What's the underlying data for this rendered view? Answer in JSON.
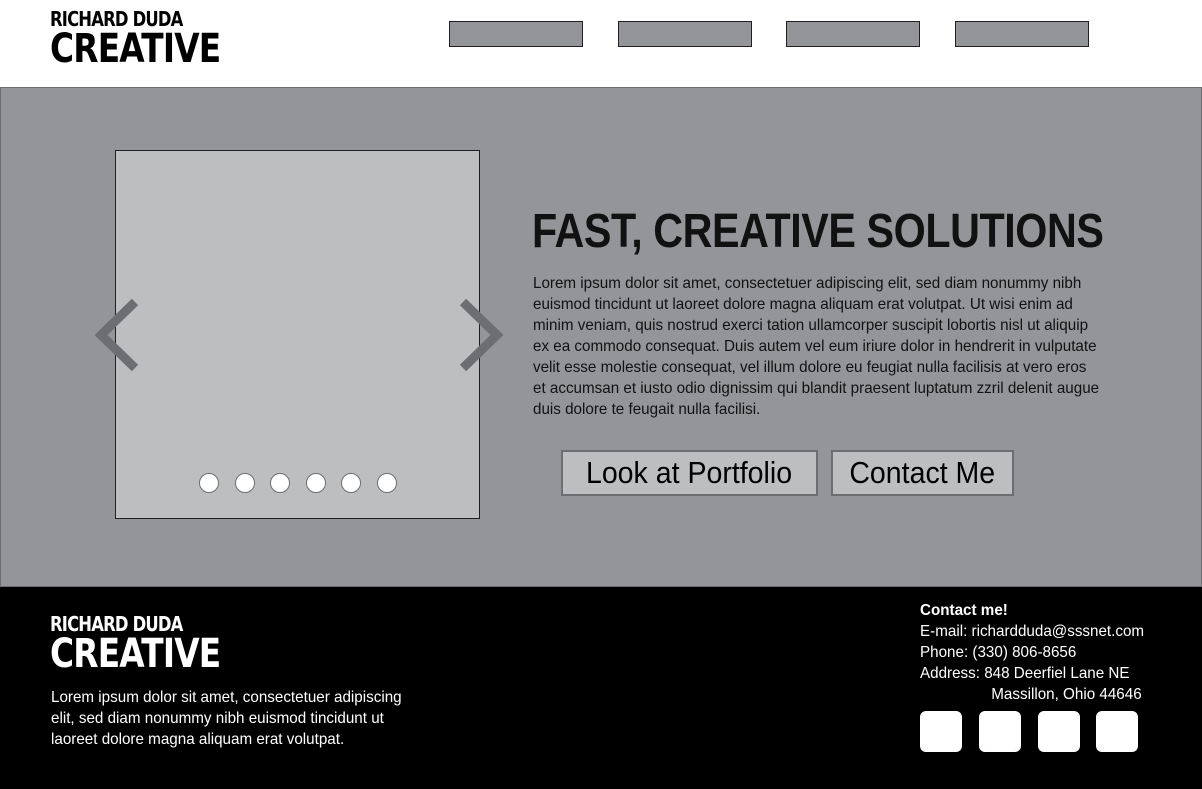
{
  "header": {
    "logo_top": "RICHARD DUDA",
    "logo_bottom": "CREATIVE"
  },
  "hero": {
    "headline": "FAST, CREATIVE SOLUTIONS",
    "body": "Lorem ipsum dolor sit amet, consectetuer adipiscing elit, sed diam nonummy nibh euismod tincidunt ut laoreet dolore magna aliquam erat volutpat. Ut wisi enim ad minim veniam, quis nostrud exerci tation ullamcorper suscipit lobortis nisl ut aliquip ex ea commodo consequat. Duis autem vel eum iriure dolor in hendrerit in vulputate velit esse molestie consequat, vel illum dolore eu feugiat nulla facilisis at vero eros et accumsan et iusto odio dignissim qui blandit praesent luptatum zzril delenit augue duis dolore te feugait nulla facilisi.",
    "portfolio_button": "Look at Portfolio",
    "contact_button": "Contact Me"
  },
  "footer": {
    "logo_top": "RICHARD DUDA",
    "logo_bottom": "CREATIVE",
    "text": "Lorem ipsum dolor sit amet, consectetuer adipiscing elit, sed diam nonummy nibh euismod tincidunt ut laoreet dolore magna aliquam erat volutpat.",
    "contact_title": "Contact me!",
    "email": "E-mail: richardduda@sssnet.com",
    "phone": "Phone:  (330) 806-8656",
    "address_line1": "Address:  848 Deerfiel Lane NE",
    "address_line2": "Massillon, Ohio 44646"
  },
  "colors": {
    "hero_bg": "#939598",
    "slider_bg": "#bcbec0",
    "footer_bg": "#000000",
    "arrow": "#6d6e71"
  }
}
